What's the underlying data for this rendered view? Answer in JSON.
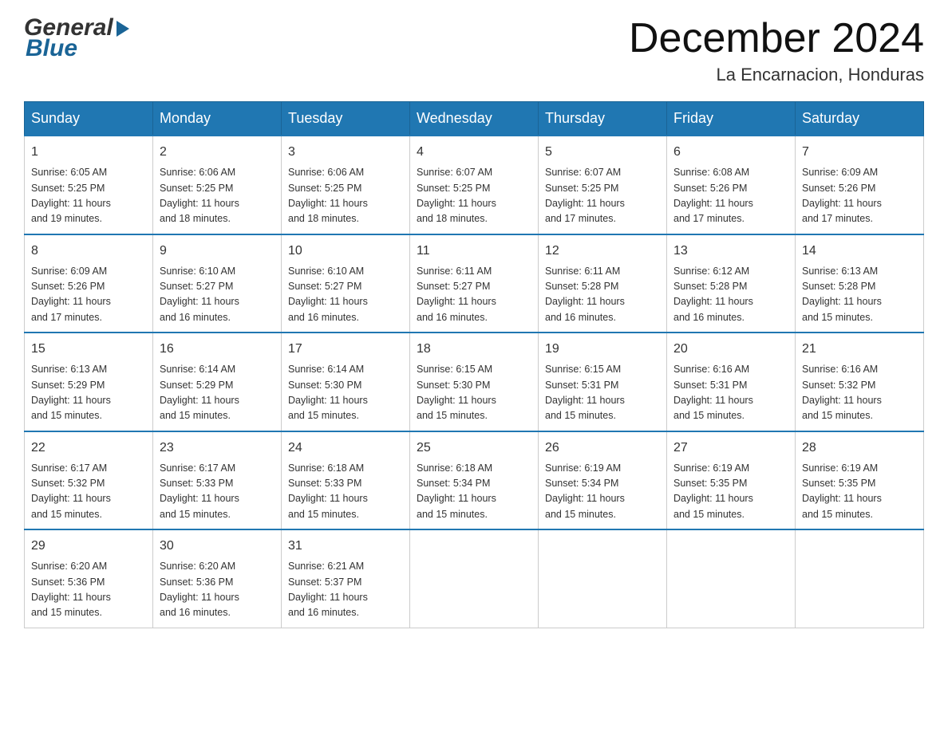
{
  "header": {
    "logo": {
      "general": "General",
      "blue": "Blue"
    },
    "title": "December 2024",
    "subtitle": "La Encarnacion, Honduras"
  },
  "calendar": {
    "days": [
      "Sunday",
      "Monday",
      "Tuesday",
      "Wednesday",
      "Thursday",
      "Friday",
      "Saturday"
    ],
    "weeks": [
      {
        "days": [
          {
            "num": "1",
            "sunrise": "6:05 AM",
            "sunset": "5:25 PM",
            "daylight": "11 hours and 19 minutes."
          },
          {
            "num": "2",
            "sunrise": "6:06 AM",
            "sunset": "5:25 PM",
            "daylight": "11 hours and 18 minutes."
          },
          {
            "num": "3",
            "sunrise": "6:06 AM",
            "sunset": "5:25 PM",
            "daylight": "11 hours and 18 minutes."
          },
          {
            "num": "4",
            "sunrise": "6:07 AM",
            "sunset": "5:25 PM",
            "daylight": "11 hours and 18 minutes."
          },
          {
            "num": "5",
            "sunrise": "6:07 AM",
            "sunset": "5:25 PM",
            "daylight": "11 hours and 17 minutes."
          },
          {
            "num": "6",
            "sunrise": "6:08 AM",
            "sunset": "5:26 PM",
            "daylight": "11 hours and 17 minutes."
          },
          {
            "num": "7",
            "sunrise": "6:09 AM",
            "sunset": "5:26 PM",
            "daylight": "11 hours and 17 minutes."
          }
        ]
      },
      {
        "days": [
          {
            "num": "8",
            "sunrise": "6:09 AM",
            "sunset": "5:26 PM",
            "daylight": "11 hours and 17 minutes."
          },
          {
            "num": "9",
            "sunrise": "6:10 AM",
            "sunset": "5:27 PM",
            "daylight": "11 hours and 16 minutes."
          },
          {
            "num": "10",
            "sunrise": "6:10 AM",
            "sunset": "5:27 PM",
            "daylight": "11 hours and 16 minutes."
          },
          {
            "num": "11",
            "sunrise": "6:11 AM",
            "sunset": "5:27 PM",
            "daylight": "11 hours and 16 minutes."
          },
          {
            "num": "12",
            "sunrise": "6:11 AM",
            "sunset": "5:28 PM",
            "daylight": "11 hours and 16 minutes."
          },
          {
            "num": "13",
            "sunrise": "6:12 AM",
            "sunset": "5:28 PM",
            "daylight": "11 hours and 16 minutes."
          },
          {
            "num": "14",
            "sunrise": "6:13 AM",
            "sunset": "5:28 PM",
            "daylight": "11 hours and 15 minutes."
          }
        ]
      },
      {
        "days": [
          {
            "num": "15",
            "sunrise": "6:13 AM",
            "sunset": "5:29 PM",
            "daylight": "11 hours and 15 minutes."
          },
          {
            "num": "16",
            "sunrise": "6:14 AM",
            "sunset": "5:29 PM",
            "daylight": "11 hours and 15 minutes."
          },
          {
            "num": "17",
            "sunrise": "6:14 AM",
            "sunset": "5:30 PM",
            "daylight": "11 hours and 15 minutes."
          },
          {
            "num": "18",
            "sunrise": "6:15 AM",
            "sunset": "5:30 PM",
            "daylight": "11 hours and 15 minutes."
          },
          {
            "num": "19",
            "sunrise": "6:15 AM",
            "sunset": "5:31 PM",
            "daylight": "11 hours and 15 minutes."
          },
          {
            "num": "20",
            "sunrise": "6:16 AM",
            "sunset": "5:31 PM",
            "daylight": "11 hours and 15 minutes."
          },
          {
            "num": "21",
            "sunrise": "6:16 AM",
            "sunset": "5:32 PM",
            "daylight": "11 hours and 15 minutes."
          }
        ]
      },
      {
        "days": [
          {
            "num": "22",
            "sunrise": "6:17 AM",
            "sunset": "5:32 PM",
            "daylight": "11 hours and 15 minutes."
          },
          {
            "num": "23",
            "sunrise": "6:17 AM",
            "sunset": "5:33 PM",
            "daylight": "11 hours and 15 minutes."
          },
          {
            "num": "24",
            "sunrise": "6:18 AM",
            "sunset": "5:33 PM",
            "daylight": "11 hours and 15 minutes."
          },
          {
            "num": "25",
            "sunrise": "6:18 AM",
            "sunset": "5:34 PM",
            "daylight": "11 hours and 15 minutes."
          },
          {
            "num": "26",
            "sunrise": "6:19 AM",
            "sunset": "5:34 PM",
            "daylight": "11 hours and 15 minutes."
          },
          {
            "num": "27",
            "sunrise": "6:19 AM",
            "sunset": "5:35 PM",
            "daylight": "11 hours and 15 minutes."
          },
          {
            "num": "28",
            "sunrise": "6:19 AM",
            "sunset": "5:35 PM",
            "daylight": "11 hours and 15 minutes."
          }
        ]
      },
      {
        "days": [
          {
            "num": "29",
            "sunrise": "6:20 AM",
            "sunset": "5:36 PM",
            "daylight": "11 hours and 15 minutes."
          },
          {
            "num": "30",
            "sunrise": "6:20 AM",
            "sunset": "5:36 PM",
            "daylight": "11 hours and 16 minutes."
          },
          {
            "num": "31",
            "sunrise": "6:21 AM",
            "sunset": "5:37 PM",
            "daylight": "11 hours and 16 minutes."
          },
          null,
          null,
          null,
          null
        ]
      }
    ],
    "labels": {
      "sunrise": "Sunrise: ",
      "sunset": "Sunset: ",
      "daylight": "Daylight: "
    }
  }
}
